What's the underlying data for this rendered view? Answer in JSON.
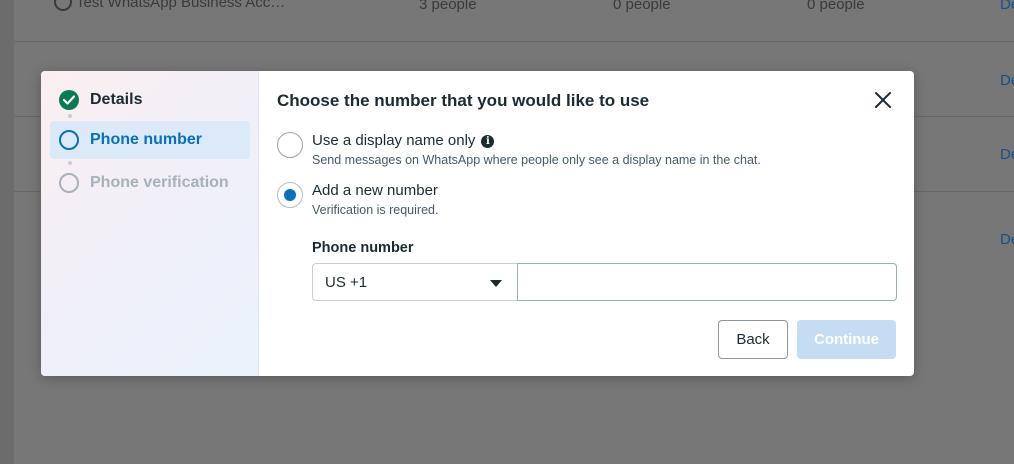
{
  "background": {
    "row1": {
      "account": "Test WhatsApp Business Acc…",
      "col2": "3 people",
      "col3": "0 people",
      "col4": "0 people",
      "link": "De"
    },
    "row2": {
      "link": "De"
    },
    "row3": {
      "link": "De"
    },
    "row4": {
      "link": "De"
    }
  },
  "steps": [
    {
      "label": "Details",
      "status": "complete"
    },
    {
      "label": "Phone number",
      "status": "active"
    },
    {
      "label": "Phone verification",
      "status": "pending"
    }
  ],
  "dialog": {
    "title": "Choose the number that you would like to use",
    "options": [
      {
        "label": "Use a display name only",
        "description": "Send messages on WhatsApp where people only see a display name in the chat.",
        "selected": false,
        "has_info_icon": true
      },
      {
        "label": "Add a new number",
        "description": "Verification is required.",
        "selected": true
      }
    ],
    "phone_field": {
      "label": "Phone number",
      "country_code": "US +1",
      "value": "",
      "placeholder": ""
    },
    "buttons": {
      "back": "Back",
      "continue": "Continue"
    }
  },
  "colors": {
    "accent": "#0a70b8",
    "success": "#0a7a55",
    "continue_disabled": "#c5ddf2"
  }
}
